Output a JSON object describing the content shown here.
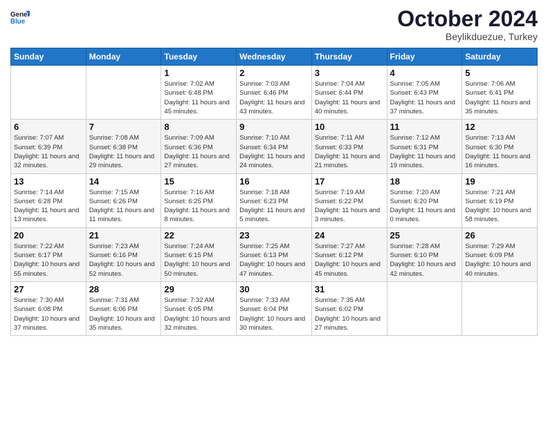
{
  "header": {
    "logo_line1": "General",
    "logo_line2": "Blue",
    "month_title": "October 2024",
    "location": "Beylikduezue, Turkey"
  },
  "days_of_week": [
    "Sunday",
    "Monday",
    "Tuesday",
    "Wednesday",
    "Thursday",
    "Friday",
    "Saturday"
  ],
  "weeks": [
    [
      {
        "day": "",
        "info": ""
      },
      {
        "day": "",
        "info": ""
      },
      {
        "day": "1",
        "info": "Sunrise: 7:02 AM\nSunset: 6:48 PM\nDaylight: 11 hours and 45 minutes."
      },
      {
        "day": "2",
        "info": "Sunrise: 7:03 AM\nSunset: 6:46 PM\nDaylight: 11 hours and 43 minutes."
      },
      {
        "day": "3",
        "info": "Sunrise: 7:04 AM\nSunset: 6:44 PM\nDaylight: 11 hours and 40 minutes."
      },
      {
        "day": "4",
        "info": "Sunrise: 7:05 AM\nSunset: 6:43 PM\nDaylight: 11 hours and 37 minutes."
      },
      {
        "day": "5",
        "info": "Sunrise: 7:06 AM\nSunset: 6:41 PM\nDaylight: 11 hours and 35 minutes."
      }
    ],
    [
      {
        "day": "6",
        "info": "Sunrise: 7:07 AM\nSunset: 6:39 PM\nDaylight: 11 hours and 32 minutes."
      },
      {
        "day": "7",
        "info": "Sunrise: 7:08 AM\nSunset: 6:38 PM\nDaylight: 11 hours and 29 minutes."
      },
      {
        "day": "8",
        "info": "Sunrise: 7:09 AM\nSunset: 6:36 PM\nDaylight: 11 hours and 27 minutes."
      },
      {
        "day": "9",
        "info": "Sunrise: 7:10 AM\nSunset: 6:34 PM\nDaylight: 11 hours and 24 minutes."
      },
      {
        "day": "10",
        "info": "Sunrise: 7:11 AM\nSunset: 6:33 PM\nDaylight: 11 hours and 21 minutes."
      },
      {
        "day": "11",
        "info": "Sunrise: 7:12 AM\nSunset: 6:31 PM\nDaylight: 11 hours and 19 minutes."
      },
      {
        "day": "12",
        "info": "Sunrise: 7:13 AM\nSunset: 6:30 PM\nDaylight: 11 hours and 16 minutes."
      }
    ],
    [
      {
        "day": "13",
        "info": "Sunrise: 7:14 AM\nSunset: 6:28 PM\nDaylight: 11 hours and 13 minutes."
      },
      {
        "day": "14",
        "info": "Sunrise: 7:15 AM\nSunset: 6:26 PM\nDaylight: 11 hours and 11 minutes."
      },
      {
        "day": "15",
        "info": "Sunrise: 7:16 AM\nSunset: 6:25 PM\nDaylight: 11 hours and 8 minutes."
      },
      {
        "day": "16",
        "info": "Sunrise: 7:18 AM\nSunset: 6:23 PM\nDaylight: 11 hours and 5 minutes."
      },
      {
        "day": "17",
        "info": "Sunrise: 7:19 AM\nSunset: 6:22 PM\nDaylight: 11 hours and 3 minutes."
      },
      {
        "day": "18",
        "info": "Sunrise: 7:20 AM\nSunset: 6:20 PM\nDaylight: 11 hours and 0 minutes."
      },
      {
        "day": "19",
        "info": "Sunrise: 7:21 AM\nSunset: 6:19 PM\nDaylight: 10 hours and 58 minutes."
      }
    ],
    [
      {
        "day": "20",
        "info": "Sunrise: 7:22 AM\nSunset: 6:17 PM\nDaylight: 10 hours and 55 minutes."
      },
      {
        "day": "21",
        "info": "Sunrise: 7:23 AM\nSunset: 6:16 PM\nDaylight: 10 hours and 52 minutes."
      },
      {
        "day": "22",
        "info": "Sunrise: 7:24 AM\nSunset: 6:15 PM\nDaylight: 10 hours and 50 minutes."
      },
      {
        "day": "23",
        "info": "Sunrise: 7:25 AM\nSunset: 6:13 PM\nDaylight: 10 hours and 47 minutes."
      },
      {
        "day": "24",
        "info": "Sunrise: 7:27 AM\nSunset: 6:12 PM\nDaylight: 10 hours and 45 minutes."
      },
      {
        "day": "25",
        "info": "Sunrise: 7:28 AM\nSunset: 6:10 PM\nDaylight: 10 hours and 42 minutes."
      },
      {
        "day": "26",
        "info": "Sunrise: 7:29 AM\nSunset: 6:09 PM\nDaylight: 10 hours and 40 minutes."
      }
    ],
    [
      {
        "day": "27",
        "info": "Sunrise: 7:30 AM\nSunset: 6:08 PM\nDaylight: 10 hours and 37 minutes."
      },
      {
        "day": "28",
        "info": "Sunrise: 7:31 AM\nSunset: 6:06 PM\nDaylight: 10 hours and 35 minutes."
      },
      {
        "day": "29",
        "info": "Sunrise: 7:32 AM\nSunset: 6:05 PM\nDaylight: 10 hours and 32 minutes."
      },
      {
        "day": "30",
        "info": "Sunrise: 7:33 AM\nSunset: 6:04 PM\nDaylight: 10 hours and 30 minutes."
      },
      {
        "day": "31",
        "info": "Sunrise: 7:35 AM\nSunset: 6:02 PM\nDaylight: 10 hours and 27 minutes."
      },
      {
        "day": "",
        "info": ""
      },
      {
        "day": "",
        "info": ""
      }
    ]
  ]
}
